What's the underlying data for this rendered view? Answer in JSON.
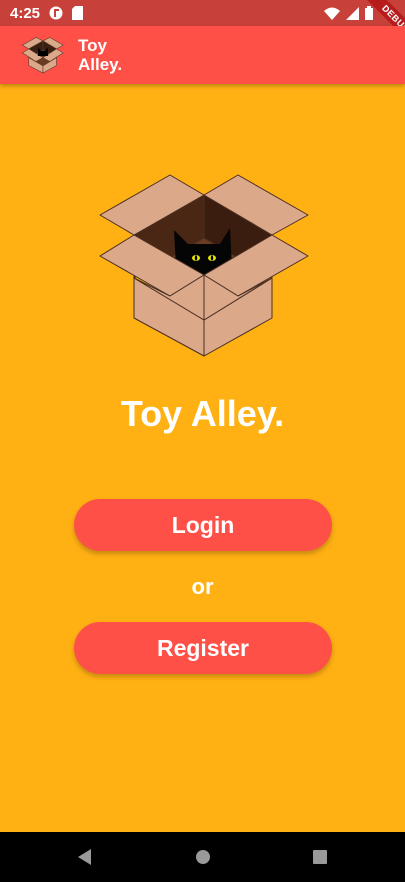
{
  "status_bar": {
    "time": "4:25",
    "icons": [
      "app-notification-icon",
      "sd-card-icon",
      "wifi-icon",
      "signal-icon",
      "battery-icon"
    ]
  },
  "app_bar": {
    "title": "Toy\nAlley.",
    "logo_icon": "cardboard-box-cat-icon",
    "background": "#FF5048"
  },
  "debug_banner": {
    "label": "DEBUG"
  },
  "main": {
    "background": "#FFB013",
    "hero_icon": "cardboard-box-cat-icon",
    "title": "Toy Alley.",
    "login_label": "Login",
    "or_label": "or",
    "register_label": "Register",
    "button_color": "#FF5048"
  },
  "nav_bar": {
    "icons": [
      "back-triangle-icon",
      "home-circle-icon",
      "recents-square-icon"
    ]
  }
}
